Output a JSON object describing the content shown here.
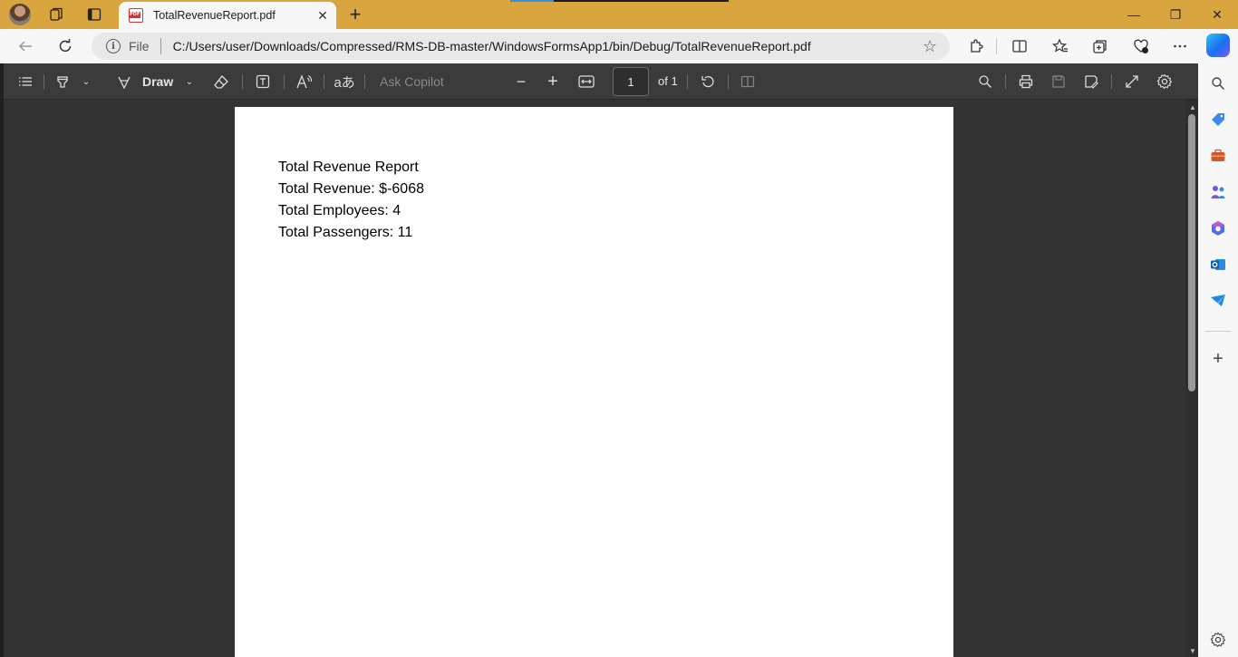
{
  "browser": {
    "tab_title": "TotalRevenueReport.pdf",
    "tab_close": "✕",
    "new_tab": "+",
    "window_controls": {
      "minimize": "—",
      "restore": "❐",
      "close": "✕"
    }
  },
  "addressbar": {
    "scheme_label": "File",
    "url": "C:/Users/user/Downloads/Compressed/RMS-DB-master/WindowsFormsApp1/bin/Debug/TotalRevenueReport.pdf"
  },
  "pdf_toolbar": {
    "draw_label": "Draw",
    "ask_copilot": "Ask Copilot",
    "page_number": "1",
    "page_total": "of 1"
  },
  "document": {
    "lines": [
      "Total Revenue Report",
      "Total Revenue: $-6068",
      "Total Employees: 4",
      "Total Passengers: 11"
    ]
  },
  "icons": {
    "titlebar": [
      "avatar",
      "workspaces-icon",
      "tab-actions-icon"
    ],
    "nav": [
      "back-icon",
      "refresh-icon"
    ],
    "toolbar": [
      "extensions-icon",
      "split-screen-icon",
      "favorites-icon",
      "collections-icon",
      "browser-essentials-icon",
      "more-icon",
      "copilot-icon"
    ],
    "pdf": [
      "contents-icon",
      "highlight-icon",
      "draw-icon",
      "erase-icon",
      "text-icon",
      "read-aloud-icon",
      "translate-icon",
      "zoom-out-icon",
      "zoom-in-icon",
      "fit-width-icon",
      "rotate-icon",
      "page-view-icon",
      "search-icon",
      "print-icon",
      "save-icon",
      "save-as-icon",
      "fullscreen-icon",
      "settings-icon"
    ],
    "sidebar": [
      "search-icon",
      "shopping-icon",
      "tools-icon",
      "games-icon",
      "microsoft365-icon",
      "outlook-icon",
      "drop-icon",
      "add-icon",
      "settings-icon"
    ]
  },
  "colors": {
    "titlebar": "#d9a53f",
    "pdf_toolbar": "#3b3b3b",
    "viewer_bg": "#333333",
    "accent": "#1b6ef3"
  }
}
